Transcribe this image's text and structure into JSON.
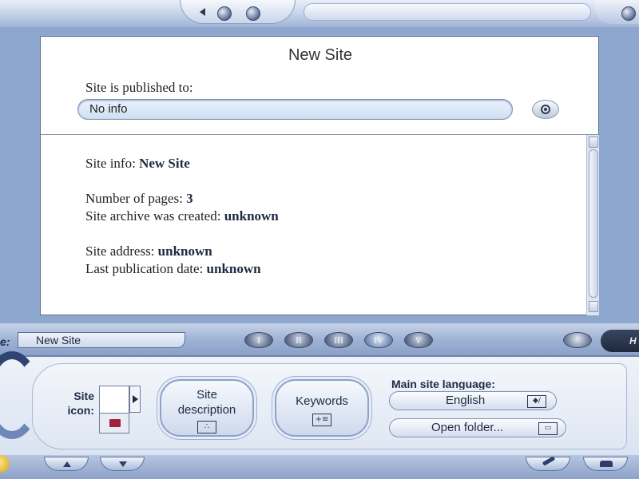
{
  "panel": {
    "title": "New Site",
    "published_label": "Site is published to:",
    "published_value": "No info",
    "info": {
      "site_info_label": "Site info: ",
      "site_info_value": "New Site",
      "pages_label": "Number of pages: ",
      "pages_value": "3",
      "archive_label": "Site archive was created: ",
      "archive_value": "unknown",
      "address_label": "Site address: ",
      "address_value": "unknown",
      "publication_label": "Last publication date: ",
      "publication_value": "unknown"
    }
  },
  "toolbar": {
    "name_prefix": "e:",
    "name_value": "New Site",
    "roman_tabs": [
      "I",
      "II",
      "III",
      "IV",
      "V"
    ],
    "active_tab": "IV",
    "help_label": "H"
  },
  "lower": {
    "site_icon_label_line1": "Site",
    "site_icon_label_line2": "icon:",
    "site_description_label_line1": "Site",
    "site_description_label_line2": "description",
    "keywords_label": "Keywords",
    "language_label": "Main site language:",
    "language_value": "English",
    "open_folder_label": "Open folder..."
  },
  "icons": {
    "top": [
      "back-arrow-icon",
      "globe-icon",
      "menu-icon"
    ],
    "view": "eye-icon",
    "settings": "settings-icon",
    "nav": [
      "up-arrow-icon",
      "down-arrow-icon",
      "tools-icon",
      "upload-icon"
    ]
  },
  "colors": {
    "chrome_blue": "#8ea7cf",
    "panel_bg": "#ffffff",
    "field_bg": "#d7e6f4",
    "text_dark": "#1f2a44"
  }
}
